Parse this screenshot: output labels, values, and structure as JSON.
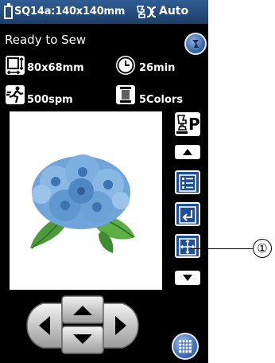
{
  "header": {
    "title": "SQ14a:140x140mm",
    "auto_label": "Auto"
  },
  "status": {
    "text": "Ready to Sew"
  },
  "info": {
    "size": "80x68mm",
    "time": "26min",
    "speed": "500spm",
    "colors": "5Colors"
  },
  "buttons": {
    "back": "back-arrow-icon",
    "presser_letter": "P",
    "scroll_up": "triangle-up",
    "color_list": "list-icon",
    "return": "return-icon",
    "move": "move-crosshair-icon",
    "scroll_down": "triangle-down",
    "grid": "grid-icon"
  },
  "callout": {
    "label": "①"
  }
}
